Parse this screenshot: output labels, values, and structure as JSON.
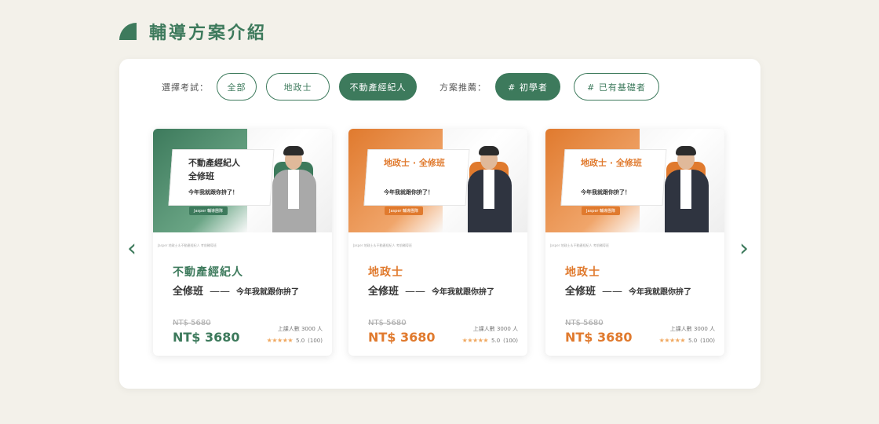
{
  "section_title": "輔導方案介紹",
  "filters": {
    "exam_label": "選擇考試：",
    "exam_options": [
      "全部",
      "地政士",
      "不動產經紀人"
    ],
    "exam_active": "不動產經紀人",
    "plan_label": "方案推薦：",
    "plan_options": [
      "# 初學者",
      "# 已有基礎者"
    ],
    "plan_active": "# 初學者"
  },
  "nav": {
    "prev_icon": "‹",
    "next_icon": "›"
  },
  "cards": [
    {
      "banner_title_1": "不動產經紀人",
      "banner_title_2": "全修班",
      "banner_slogan": "今年我就跟你拚了！",
      "banner_tag": "Jasper 輔導團隊",
      "fine_print": "Jasper 地政士＆不動產經紀人 考前輔導班",
      "name": "不動產經紀人",
      "course": "全修班",
      "dash": "——",
      "slogan": "今年我就跟你拚了",
      "old_price": "NT$ 5680",
      "new_price": "NT$ 3680",
      "students": "上課人數 3000 人",
      "stars": "★★★★★",
      "rating": "5.0",
      "reviews": "(100)",
      "accent": "#3d7a5c"
    },
    {
      "banner_title_1": "地政士 · 全修班",
      "banner_title_2": "",
      "banner_slogan": "今年我就跟你拚了！",
      "banner_tag": "Jasper 輔導團隊",
      "fine_print": "Jasper 地政士＆不動產經紀人 考前輔導班",
      "name": "地政士",
      "course": "全修班",
      "dash": "——",
      "slogan": "今年我就跟你拚了",
      "old_price": "NT$ 5680",
      "new_price": "NT$ 3680",
      "students": "上課人數 3000 人",
      "stars": "★★★★★",
      "rating": "5.0",
      "reviews": "(100)",
      "accent": "#e07a2e"
    },
    {
      "banner_title_1": "地政士 · 全修班",
      "banner_title_2": "",
      "banner_slogan": "今年我就跟你拚了！",
      "banner_tag": "Jasper 輔導團隊",
      "fine_print": "Jasper 地政士＆不動產經紀人 考前輔導班",
      "name": "地政士",
      "course": "全修班",
      "dash": "——",
      "slogan": "今年我就跟你拚了",
      "old_price": "NT$ 5680",
      "new_price": "NT$ 3680",
      "students": "上課人數 3000 人",
      "stars": "★★★★★",
      "rating": "5.0",
      "reviews": "(100)",
      "accent": "#e07a2e"
    }
  ],
  "colors": {
    "primary": "#3d7a5c",
    "orange": "#e07a2e",
    "background": "#f3f1ea"
  }
}
